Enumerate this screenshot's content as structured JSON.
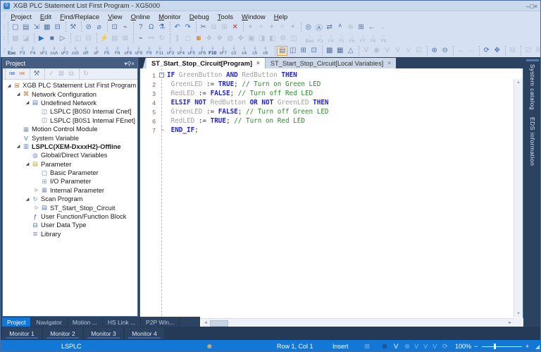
{
  "colors": {
    "accent_blue": "#1377d6",
    "dark_navy": "#2b4260",
    "panel_header": "#455d80",
    "keyword": "#2121df",
    "identifier": "#a0a0a0",
    "comment": "#2e8b2e",
    "line_number": "#a34f4f",
    "chrome": "#d5e1f2"
  },
  "window": {
    "title": "XGB PLC Statement List First Program - XG5000",
    "controls": [
      [
        "minimize-button",
        "–"
      ],
      [
        "maximize-button",
        "□"
      ],
      [
        "close-button",
        "×"
      ]
    ]
  },
  "menu": {
    "items": [
      "Project",
      "Edit",
      "Find/Replace",
      "View",
      "Online",
      "Monitor",
      "Debug",
      "Tools",
      "Window",
      "Help"
    ]
  },
  "toolbars": {
    "row1": [
      [
        [
          "new-file-icon",
          "▢",
          ""
        ],
        [
          "open-project-icon",
          "▤",
          ""
        ],
        [
          "import-project-icon",
          "⇲",
          ""
        ],
        [
          "save-project-icon",
          "▦",
          ""
        ],
        [
          "print-icon",
          "⊟",
          ""
        ]
      ],
      [
        [
          "settings-wrench-icon",
          "⚒",
          "slate"
        ]
      ],
      [
        [
          "connection-settings-icon",
          "⊘",
          ""
        ],
        [
          "disconnect-icon",
          "⌀",
          ""
        ]
      ],
      [
        [
          "monitor-display-icon",
          "⊡",
          ""
        ],
        [
          "plug-icon",
          "⌁",
          ""
        ]
      ],
      [
        [
          "help-icon",
          "?",
          ""
        ],
        [
          "user-tools-icon",
          "Ω",
          ""
        ],
        [
          "simulator-icon",
          "⚗",
          ""
        ]
      ],
      [
        [
          "undo-icon",
          "↶",
          "blu"
        ],
        [
          "redo-icon",
          "↷",
          "blu"
        ]
      ],
      [
        [
          "cut-icon",
          "✂",
          ""
        ],
        [
          "copy-icon",
          "⧉",
          "dis"
        ],
        [
          "paste-icon",
          "⊞",
          "dis"
        ],
        [
          "delete-icon",
          "✕",
          "red"
        ]
      ],
      [
        [
          "rung-tool-1-icon",
          "✦",
          "dis"
        ],
        [
          "rung-tool-2-icon",
          "✧",
          "dis"
        ],
        [
          "rung-tool-3-icon",
          "✦",
          "dis"
        ],
        [
          "rung-tool-4-icon",
          "✧",
          "dis"
        ],
        [
          "rung-tool-5-icon",
          "✦",
          "dis"
        ]
      ],
      [
        [
          "find-device-icon",
          "◎",
          ""
        ],
        [
          "find-text-icon",
          "Ⓐ",
          ""
        ],
        [
          "swap-icon",
          "⇄",
          ""
        ],
        [
          "replace-text-icon",
          "ᴬ",
          ""
        ],
        [
          "zoom-find-icon",
          "⊕",
          "dis"
        ],
        [
          "table-view-icon",
          "⊞",
          ""
        ],
        [
          "navigate-back-icon",
          "←",
          "blu"
        ],
        [
          "navigate-forward-icon",
          "→",
          "dis"
        ]
      ]
    ],
    "row2": [
      [
        [
          "compile-icon",
          "▩",
          "dis"
        ],
        [
          "compile-all-icon",
          "◪",
          "dis"
        ]
      ],
      [
        [
          "run-icon",
          "▶",
          "blu"
        ],
        [
          "stop-icon",
          "■",
          ""
        ],
        [
          "step-run-icon",
          "▷",
          ""
        ]
      ],
      [
        [
          "chart-view-1-icon",
          "◫",
          "dis"
        ],
        [
          "chart-view-2-icon",
          "⊟",
          "dis"
        ]
      ],
      [
        [
          "flash-write-icon",
          "⚡",
          "dis"
        ],
        [
          "memory-view-icon",
          "▤",
          "dis"
        ],
        [
          "clear-memory-icon",
          "⊠",
          "dis"
        ]
      ],
      [
        [
          "connect-icon",
          "⌁",
          ""
        ],
        [
          "connection-options-icon",
          "⚯",
          "dis"
        ],
        [
          "reset-plc-icon",
          "↻",
          "dis"
        ]
      ],
      [
        [
          "pause-monitor-icon",
          "∥",
          "dis"
        ],
        [
          "stop-monitor-icon",
          "◻",
          "dis"
        ],
        [
          "start-monitor-icon",
          "◙",
          "acc"
        ],
        [
          "monitor-tool-1-icon",
          "❖",
          "dis"
        ],
        [
          "monitor-tool-2-icon",
          "✥",
          "dis"
        ],
        [
          "monitor-tool-3-icon",
          "◍",
          "dis"
        ],
        [
          "monitor-tool-4-icon",
          "✤",
          "dis"
        ],
        [
          "monitor-tool-5-icon",
          "▣",
          "dis"
        ],
        [
          "monitor-tool-6-icon",
          "◨",
          "dis"
        ],
        [
          "monitor-tool-7-icon",
          "◧",
          "dis"
        ],
        [
          "monitor-tool-8-icon",
          "⚙",
          "dis"
        ],
        [
          "monitor-tool-9-icon",
          "◫",
          "dis"
        ]
      ]
    ],
    "row3_right": [
      [
        [
          "window-project-icon",
          "▤",
          "sel"
        ],
        [
          "window-variables-icon",
          "◫",
          ""
        ],
        [
          "window-message-icon",
          "⊞",
          ""
        ],
        [
          "window-memory-icon",
          "⊡",
          ""
        ]
      ],
      [
        [
          "device-view-icon",
          "▩",
          ""
        ],
        [
          "module-view-icon",
          "▦",
          ""
        ],
        [
          "special-view-icon",
          "△",
          ""
        ]
      ],
      [
        [
          "var-monitor-1-icon",
          "V",
          "dis"
        ],
        [
          "var-monitor-2-icon",
          "◉",
          "dis"
        ],
        [
          "var-monitor-3-icon",
          "V",
          "dis"
        ],
        [
          "var-monitor-4-icon",
          "V",
          "dis"
        ],
        [
          "var-monitor-5-icon",
          "V",
          "dis"
        ],
        [
          "var-monitor-6-icon",
          "☑",
          "dis"
        ]
      ],
      [
        [
          "zoom-in-icon",
          "⊕",
          ""
        ],
        [
          "zoom-out-icon",
          "⊖",
          ""
        ]
      ],
      [
        [
          "expand-width-icon",
          "↔",
          "dis"
        ],
        [
          "shrink-width-icon",
          "↔",
          "dis"
        ]
      ],
      [
        [
          "rotate-view-icon",
          "⟳",
          "blu"
        ],
        [
          "fit-screen-icon",
          "✥",
          ""
        ]
      ],
      [
        [
          "duplicate-icon",
          "⧉",
          "dis"
        ]
      ],
      [
        [
          "check-on-icon",
          "☑",
          "dis"
        ],
        [
          "check-off-icon",
          "☒",
          "dis"
        ],
        [
          "bookmark-icon",
          "⚑",
          "bookblue"
        ],
        [
          "move-window-icon",
          "✥",
          "dis"
        ]
      ]
    ],
    "fkey_glyph": "╫",
    "fkeys_main": [
      "Esc",
      "F3",
      "F4",
      "sF1",
      "csA",
      "sF2",
      "cs5",
      "sR",
      "sF",
      "F5",
      "F6",
      "sF8",
      "sF9",
      "F9",
      "F11",
      "sF3",
      "sF4",
      "sF5",
      "sF6",
      "F10",
      "sF7",
      "c3",
      "c4",
      "c5",
      "c6"
    ],
    "fkeys_bold": [
      "Esc",
      "F10"
    ],
    "fkeys_small": [
      "Esc",
      "F3",
      "F4",
      "F5",
      "F6",
      "F7",
      "F8",
      "F9"
    ]
  },
  "project_panel": {
    "title": "Project",
    "controls": [
      [
        "panel-menu-icon",
        "▾"
      ],
      [
        "pin-icon",
        "⚲"
      ],
      [
        "panel-close-icon",
        "×"
      ]
    ],
    "toolbar": [
      [
        [
          "view-variables-icon",
          "≔",
          "blu"
        ],
        [
          "view-devices-icon",
          "≔",
          "org"
        ]
      ],
      [
        [
          "project-wrench-icon",
          "⚒",
          "slate"
        ]
      ],
      [
        [
          "verify-icon",
          "✓",
          "dis"
        ],
        [
          "lock-icon",
          "⊠",
          "dis"
        ],
        [
          "compare-icon",
          "⧉",
          "dis"
        ]
      ],
      [
        [
          "refresh-tree-icon",
          "↻",
          "dis"
        ]
      ]
    ],
    "tree": [
      [
        "XGB PLC Statement List First Program",
        0,
        "open",
        "project-root",
        "⊞",
        "#c0702c",
        false
      ],
      [
        "Network Configuration",
        1,
        "open",
        "network-config",
        "⌘",
        "#c0702c",
        false
      ],
      [
        "Undefined Network",
        2,
        "open",
        "undefined-network",
        "▤",
        "#4a78c0",
        false
      ],
      [
        "LSPLC [B0S0 Internal Cnet]",
        3,
        "",
        "cnet-module",
        "◫",
        "#6e87a8",
        false
      ],
      [
        "LSPLC [B0S1 Internal FEnet]",
        3,
        "",
        "fenet-module",
        "◫",
        "#6e87a8",
        false
      ],
      [
        "Motion Control Module",
        1,
        "",
        "motion-control",
        "▦",
        "#8a97ad",
        false
      ],
      [
        "System Variable",
        1,
        "",
        "system-variable",
        "V",
        "#2c6bc4",
        false
      ],
      [
        "LSPLC(XEM-DxxxH2)-Offline",
        1,
        "open",
        "plc-cpu",
        "▥",
        "#5a7eb5",
        true
      ],
      [
        "Global/Direct Variables",
        2,
        "",
        "global-variables",
        "◎",
        "#2c6bc4",
        false
      ],
      [
        "Parameter",
        2,
        "open",
        "parameter-folder",
        "▤",
        "#c9a227",
        false
      ],
      [
        "Basic Parameter",
        3,
        "",
        "basic-parameter",
        "▢",
        "#4a78c0",
        false
      ],
      [
        "I/O Parameter",
        3,
        "",
        "io-parameter",
        "⊞",
        "#8a97ad",
        false
      ],
      [
        "Internal Parameter",
        3,
        "closed",
        "internal-parameter",
        "▦",
        "#8a97ad",
        false
      ],
      [
        "Scan Program",
        2,
        "open",
        "scan-program",
        "↻",
        "#7c94ae",
        false
      ],
      [
        "ST_Start_Stop_Circuit",
        3,
        "closed",
        "st-program",
        "▤",
        "#4a78c0",
        false
      ],
      [
        "User Function/Function Block",
        2,
        "",
        "user-function-block",
        "ƒ",
        "#2e4d80",
        false
      ],
      [
        "User Data Type",
        2,
        "",
        "user-data-type",
        "⊟",
        "#2c6bc4",
        false
      ],
      [
        "Library",
        2,
        "",
        "library",
        "≣",
        "#7a52b0",
        false
      ]
    ]
  },
  "editor": {
    "tabs": [
      {
        "label": "ST_Start_Stop_Circuit[Program]",
        "active": true
      },
      {
        "label": "ST_Start_Stop_Circuit[Local Variables]",
        "active": false
      }
    ],
    "lines": [
      {
        "n": "1",
        "fold": "box",
        "toks": [
          [
            "kw",
            "IF "
          ],
          [
            "id",
            "GreenButton "
          ],
          [
            "kw",
            "AND "
          ],
          [
            "id",
            "RedButton "
          ],
          [
            "kw",
            "THEN"
          ]
        ]
      },
      {
        "n": "2",
        "fold": "line",
        "toks": [
          [
            "pn",
            " "
          ],
          [
            "id",
            "GreenLED "
          ],
          [
            "pn",
            ":= "
          ],
          [
            "kw",
            "TRUE"
          ],
          [
            "pn",
            "; "
          ],
          [
            "cm",
            "// Turn on Green LED"
          ]
        ]
      },
      {
        "n": "3",
        "fold": "line",
        "toks": [
          [
            "pn",
            " "
          ],
          [
            "id",
            "RedLED "
          ],
          [
            "pn",
            ":= "
          ],
          [
            "kw",
            "FALSE"
          ],
          [
            "pn",
            "; "
          ],
          [
            "cm",
            "// Turn off Red LED"
          ]
        ]
      },
      {
        "n": "4",
        "fold": "line",
        "toks": [
          [
            "pn",
            " "
          ],
          [
            "kw",
            "ELSIF NOT "
          ],
          [
            "id",
            "RedButton "
          ],
          [
            "kw",
            "OR NOT "
          ],
          [
            "id",
            "GreenLED "
          ],
          [
            "kw",
            "THEN"
          ]
        ]
      },
      {
        "n": "5",
        "fold": "line",
        "toks": [
          [
            "pn",
            " "
          ],
          [
            "id",
            "GreenLED "
          ],
          [
            "pn",
            ":= "
          ],
          [
            "kw",
            "FALSE"
          ],
          [
            "pn",
            "; "
          ],
          [
            "cm",
            "// Turn off Green LED"
          ]
        ]
      },
      {
        "n": "6",
        "fold": "line",
        "toks": [
          [
            "pn",
            " "
          ],
          [
            "id",
            "RedLED "
          ],
          [
            "pn",
            ":= "
          ],
          [
            "kw",
            "TRUE"
          ],
          [
            "pn",
            "; "
          ],
          [
            "cm",
            "// Turn on Red LED"
          ]
        ]
      },
      {
        "n": "7",
        "fold": "end",
        "toks": [
          [
            "pn",
            " "
          ],
          [
            "kw",
            "END_IF"
          ],
          [
            "pn",
            ";"
          ]
        ]
      }
    ]
  },
  "right_panel": {
    "tabs": [
      "System catalog",
      "EDS information"
    ]
  },
  "dock": {
    "tabs": [
      [
        "Project",
        true
      ],
      [
        "Navigator",
        false
      ],
      [
        "Motion ...",
        false
      ],
      [
        "HS Link ...",
        false
      ],
      [
        "P2P Win...",
        false
      ]
    ]
  },
  "monitor": {
    "tabs": [
      "Monitor 1",
      "Monitor 2",
      "Monitor 3",
      "Monitor 4"
    ]
  },
  "status": {
    "device": "LSPLC",
    "row_col": "Row 1, Col 1",
    "mode": "Insert",
    "zoom_level": "100%",
    "zoom_minus": "−",
    "zoom_plus": "+",
    "icons": [
      [
        "connection-status-icon",
        "☻",
        291,
        "org2"
      ],
      [
        "io-grid-icon",
        "⊞",
        516,
        "dim"
      ],
      [
        "error-indicator-icon",
        "⊗",
        541,
        "dark"
      ],
      [
        "variable-monitor-icon",
        "V",
        558,
        ""
      ],
      [
        "status-gear-icon",
        "⊛",
        573,
        "dim"
      ],
      [
        "v-mode-1-icon",
        "V",
        587,
        "dim"
      ],
      [
        "v-mode-2-icon",
        "V",
        600,
        "dim"
      ],
      [
        "v-mode-3-icon",
        "V",
        613,
        "dim"
      ],
      [
        "status-refresh-icon",
        "⟳",
        627,
        "dim"
      ]
    ]
  }
}
